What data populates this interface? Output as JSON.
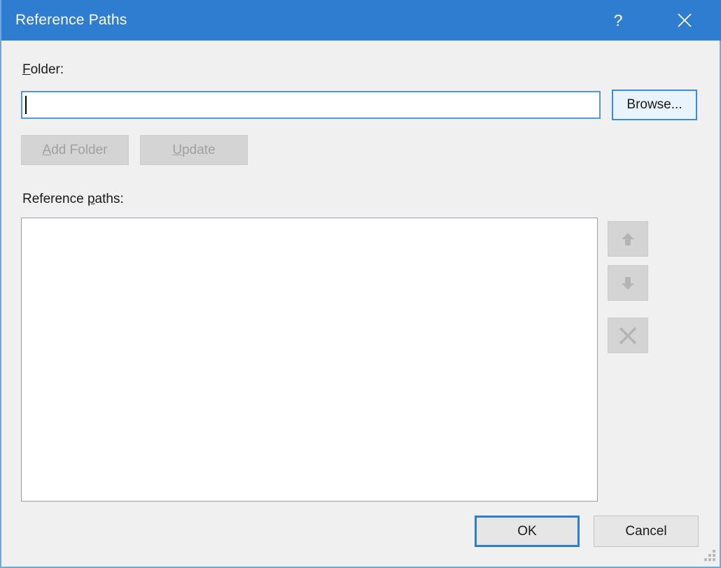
{
  "window": {
    "title": "Reference Paths",
    "accent_color": "#2f7dd1",
    "background_color": "#f0f0f0",
    "help_icon": "question-mark-icon",
    "close_icon": "close-x-icon"
  },
  "folder_section": {
    "label_prefix": "",
    "label_accel": "F",
    "label_suffix": "older:",
    "input_value": "",
    "input_placeholder": "",
    "browse_label": "Browse..."
  },
  "actions": {
    "add_folder_accel": "A",
    "add_folder_suffix": "dd Folder",
    "add_folder_enabled": false,
    "update_accel": "U",
    "update_suffix": "pdate",
    "update_enabled": false
  },
  "reference_paths": {
    "label_prefix": "Reference ",
    "label_accel": "p",
    "label_suffix": "aths:",
    "items": [],
    "move_up_icon": "arrow-up-icon",
    "move_down_icon": "arrow-down-icon",
    "delete_icon": "delete-x-icon",
    "move_up_enabled": false,
    "move_down_enabled": false,
    "delete_enabled": false
  },
  "footer": {
    "ok_label": "OK",
    "cancel_label": "Cancel",
    "default_button": "OK"
  }
}
